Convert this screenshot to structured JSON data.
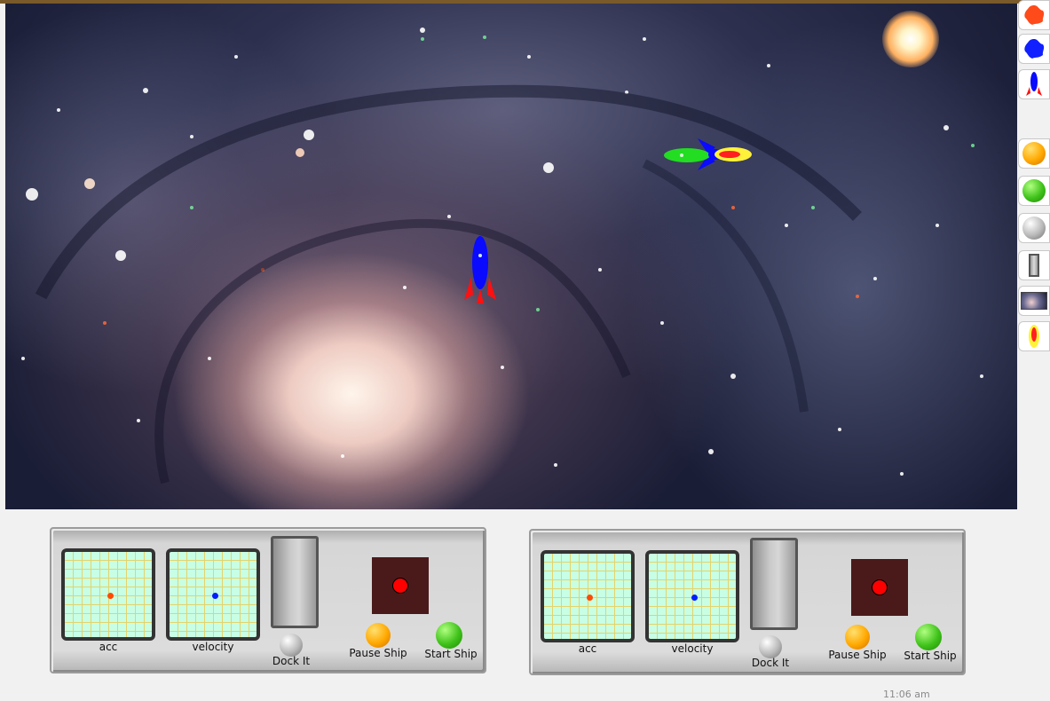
{
  "toolbar": {
    "items": [
      {
        "icon": "red-blob-icon"
      },
      {
        "icon": "blue-blob-icon"
      },
      {
        "icon": "rocket-icon"
      },
      {
        "icon": "orange-ball-icon"
      },
      {
        "icon": "green-ball-icon"
      },
      {
        "icon": "gray-ball-icon"
      },
      {
        "icon": "slider-icon"
      },
      {
        "icon": "galaxy-thumbnail-icon"
      },
      {
        "icon": "flame-icon"
      }
    ]
  },
  "panels": [
    {
      "acc_label": "acc",
      "velocity_label": "velocity",
      "dock_label": "Dock It",
      "pause_label": "Pause Ship",
      "start_label": "Start Ship"
    },
    {
      "acc_label": "acc",
      "velocity_label": "velocity",
      "dock_label": "Dock It",
      "pause_label": "Pause Ship",
      "start_label": "Start Ship"
    }
  ],
  "clock": "11:06 am",
  "colors": {
    "acc_dot": "#ff4a00",
    "velocity_dot": "#0020ff",
    "space_bg": "#1a1d36",
    "grid_bg": "#c8ffe4",
    "grid_line": "#e3d36c",
    "screen_bg": "#4a1a1a"
  }
}
